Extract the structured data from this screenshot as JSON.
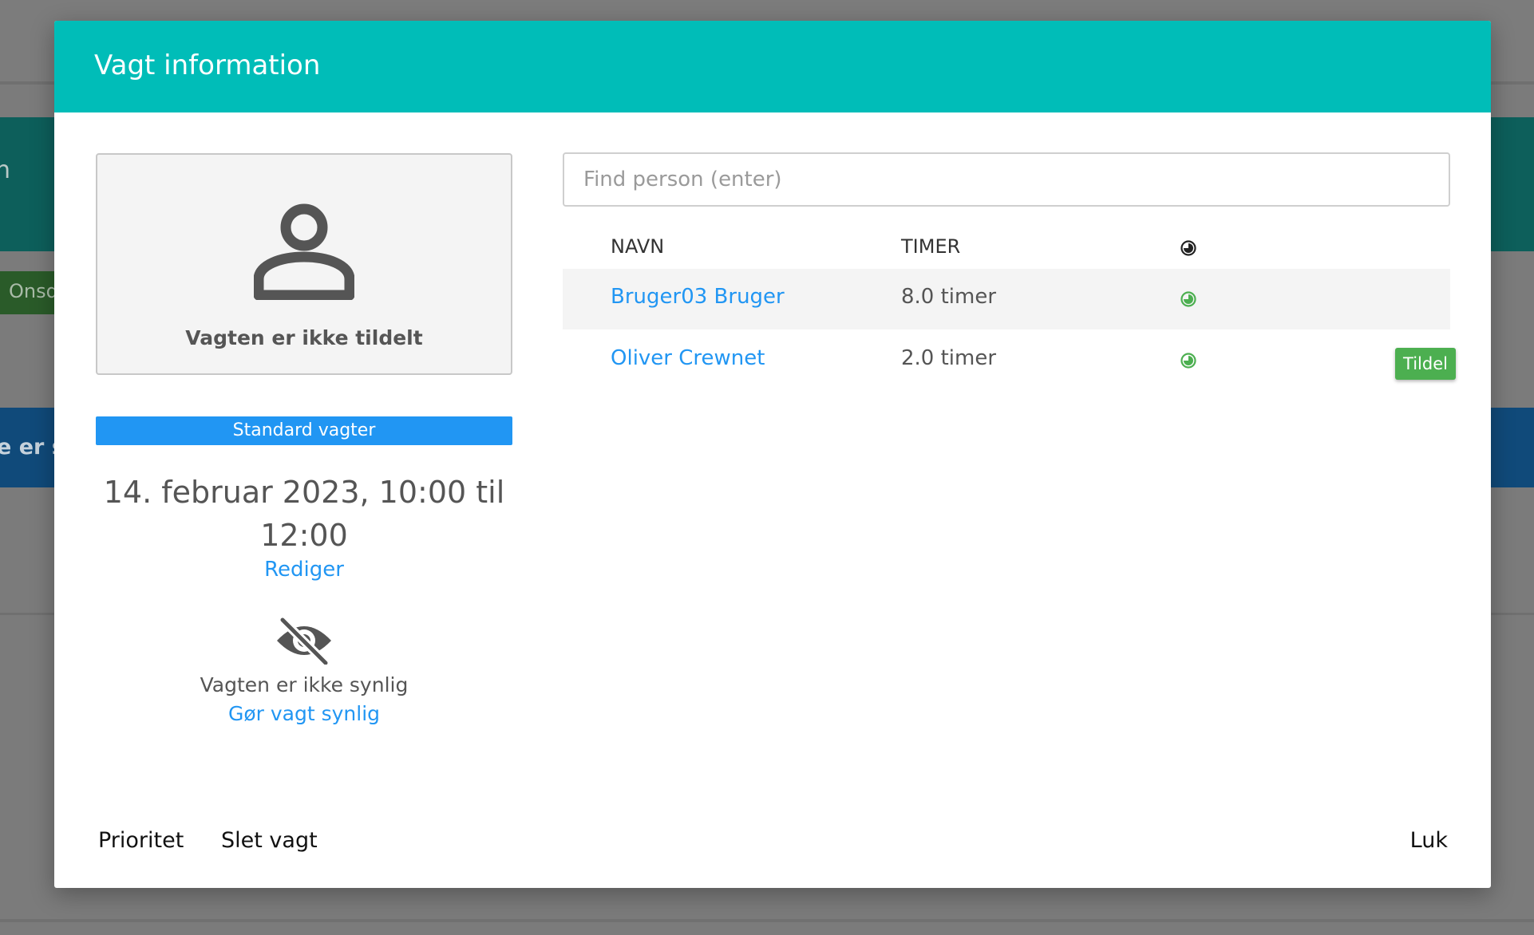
{
  "background": {
    "teal_banner_text": "n",
    "green_tab_label": "Onsd",
    "blue_banner_text": "e er sy"
  },
  "modal": {
    "title": "Vagt information",
    "header_color": "#00bdb8",
    "assignment": {
      "icon": "user-icon",
      "status_text": "Vagten er ikke tildelt"
    },
    "category": {
      "label": "Standard vagter",
      "color": "#2196f3"
    },
    "shift": {
      "time_text": "14. februar 2023, 10:00 til 12:00",
      "edit_label": "Rediger"
    },
    "visibility": {
      "icon": "eye-slash-icon",
      "status_text": "Vagten er ikke synlig",
      "action_label": "Gør vagt synlig"
    },
    "search": {
      "placeholder": "Find person (enter)",
      "value": ""
    },
    "table": {
      "headers": {
        "name": "NAVN",
        "hours": "TIMER",
        "status_icon": "clock-pie-icon"
      },
      "rows": [
        {
          "name": "Bruger03 Bruger",
          "hours": "8.0 timer",
          "status_icon": "clock-pie-icon",
          "status_color": "#4caf50",
          "action_label": ""
        },
        {
          "name": "Oliver Crewnet",
          "hours": "2.0 timer",
          "status_icon": "clock-pie-icon",
          "status_color": "#4caf50",
          "action_label": "Tildel"
        }
      ]
    },
    "footer": {
      "priority_label": "Prioritet",
      "delete_label": "Slet vagt",
      "close_label": "Luk"
    },
    "link_color": "#2196f3",
    "assign_button_color": "#4caf50"
  }
}
